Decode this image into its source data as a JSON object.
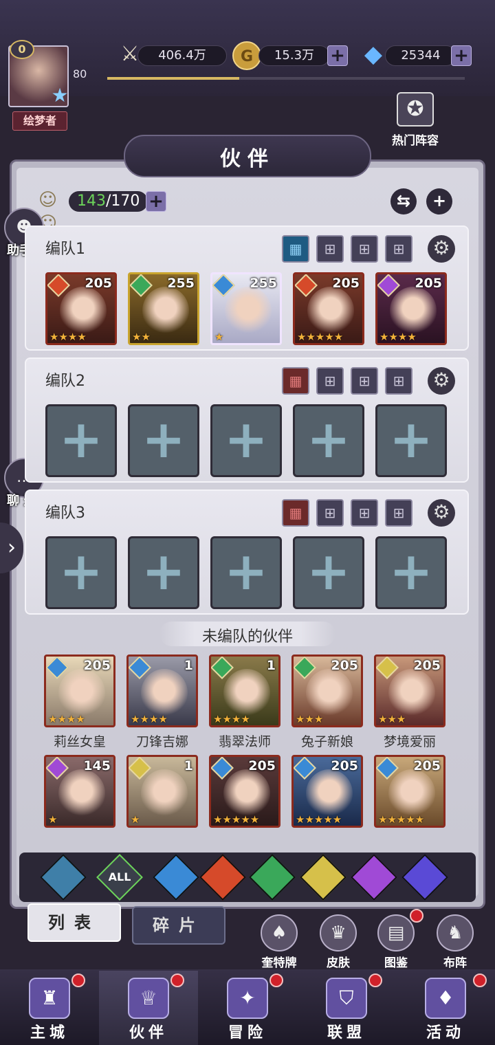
{
  "header": {
    "level_badge": "0",
    "level": "80",
    "title_tag": "绘梦者",
    "resources": [
      {
        "name": "power",
        "icon": "sword-icon",
        "value": "406.4万",
        "has_plus": false
      },
      {
        "name": "gold",
        "icon": "gold-coin-icon",
        "value": "15.3万",
        "has_plus": true
      },
      {
        "name": "diamond",
        "icon": "diamond-icon",
        "value": "25344",
        "has_plus": true
      }
    ],
    "hot_lineup": "热门阵容",
    "xp_fraction": 0.37
  },
  "page_title": "伙伴",
  "partner_count": {
    "current": "143",
    "total": "/170"
  },
  "side": {
    "helper": "助手",
    "chat": "聊 天"
  },
  "teams": [
    {
      "name": "编队1",
      "heroes": [
        {
          "level": "205",
          "element": "fire",
          "stars": 4
        },
        {
          "level": "255",
          "element": "wind",
          "stars": 2
        },
        {
          "level": "255",
          "element": "water",
          "stars": 1
        },
        {
          "level": "205",
          "element": "fire",
          "stars": 5
        },
        {
          "level": "205",
          "element": "dark",
          "stars": 4
        }
      ]
    },
    {
      "name": "编队2",
      "heroes": []
    },
    {
      "name": "编队3",
      "heroes": []
    }
  ],
  "unassigned": {
    "label": "未编队的伙伴",
    "row1": [
      {
        "name": "莉丝女皇",
        "level": "205",
        "element": "water",
        "stars": 4
      },
      {
        "name": "刀锋吉娜",
        "level": "1",
        "element": "water",
        "stars": 4
      },
      {
        "name": "翡翠法师",
        "level": "1",
        "element": "wind",
        "stars": 4
      },
      {
        "name": "兔子新娘",
        "level": "205",
        "element": "wind",
        "stars": 3
      },
      {
        "name": "梦境爱丽",
        "level": "205",
        "element": "light",
        "stars": 3
      }
    ],
    "row2": [
      {
        "level": "145",
        "element": "dark",
        "stars": 1
      },
      {
        "level": "1",
        "element": "light",
        "stars": 1
      },
      {
        "level": "205",
        "element": "water",
        "stars": 5
      },
      {
        "level": "205",
        "element": "water",
        "stars": 5
      },
      {
        "level": "205",
        "element": "water",
        "stars": 5
      }
    ]
  },
  "filters": [
    {
      "name": "tank-filter",
      "label": "",
      "color": "#3f7fa8"
    },
    {
      "name": "all-filter",
      "label": "ALL",
      "color": "#3a3f4a"
    },
    {
      "name": "water-filter",
      "label": "",
      "color": "#3a8ad6"
    },
    {
      "name": "fire-filter",
      "label": "",
      "color": "#d64a2a"
    },
    {
      "name": "wind-filter",
      "label": "",
      "color": "#3aa85a"
    },
    {
      "name": "light-filter",
      "label": "",
      "color": "#d6c04a"
    },
    {
      "name": "dark-filter",
      "label": "",
      "color": "#a04ad6"
    },
    {
      "name": "cosmos-filter",
      "label": "",
      "color": "#5a4ad6"
    }
  ],
  "subtabs": {
    "list": "列表",
    "fragments": "碎片"
  },
  "tools": [
    {
      "label": "奎特牌",
      "icon": "card-deck-icon",
      "dot": false
    },
    {
      "label": "皮肤",
      "icon": "costume-icon",
      "dot": false
    },
    {
      "label": "图鉴",
      "icon": "book-icon",
      "dot": true
    },
    {
      "label": "布阵",
      "icon": "chess-icon",
      "dot": false
    }
  ],
  "nav": [
    {
      "label": "主城",
      "icon": "castle-icon",
      "dot": true
    },
    {
      "label": "伙伴",
      "icon": "partner-icon",
      "dot": true
    },
    {
      "label": "冒险",
      "icon": "compass-icon",
      "dot": true
    },
    {
      "label": "联盟",
      "icon": "shield-icon",
      "dot": true
    },
    {
      "label": "活动",
      "icon": "cards-icon",
      "dot": true
    }
  ],
  "colors": {
    "fire": "#d64a2a",
    "water": "#3a8ad6",
    "wind": "#3aa85a",
    "light": "#d6c04a",
    "dark": "#a04ad6",
    "accent": "#7b6fa8"
  }
}
